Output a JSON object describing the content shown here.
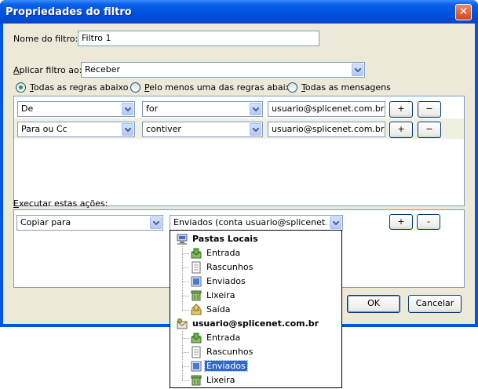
{
  "window": {
    "title": "Propriedades do filtro"
  },
  "filter_name": {
    "label": "Nome do filtro:",
    "value": "Filtro 1"
  },
  "apply_to": {
    "label_pre": "A",
    "label_post": "plicar filtro ao:",
    "value": "Receber"
  },
  "match": {
    "all_key": "T",
    "all_rest": "odas as regras abaixo",
    "any_key": "P",
    "any_rest": "elo menos uma das regras abaixo",
    "msgs_key": "T",
    "msgs_rest": "odas as mensagens",
    "selected": "Todas as regras abaixo"
  },
  "rules": [
    {
      "field": "De",
      "operator": "for",
      "value": "usuario@splicenet.com.br",
      "add": "+",
      "remove": "−"
    },
    {
      "field": "Para ou Cc",
      "operator": "contiver",
      "value": "usuario@splicenet.com.br",
      "add": "+",
      "remove": "−"
    }
  ],
  "actions": {
    "label_key": "E",
    "label_rest": "xecutar estas ações:",
    "action": "Copiar para",
    "target": "Enviados (conta usuario@splicenet.co...",
    "add": "+",
    "remove": "-"
  },
  "buttons": {
    "ok": "OK",
    "cancel": "Cancelar"
  },
  "folder_tree": {
    "groups": [
      {
        "name": "Pastas Locais",
        "icon": "computer-icon",
        "folders": [
          {
            "name": "Entrada",
            "icon": "inbox-icon"
          },
          {
            "name": "Rascunhos",
            "icon": "drafts-icon"
          },
          {
            "name": "Enviados",
            "icon": "sent-icon"
          },
          {
            "name": "Lixeira",
            "icon": "trash-icon"
          },
          {
            "name": "Saída",
            "icon": "outbox-icon"
          }
        ]
      },
      {
        "name": "usuario@splicenet.com.br",
        "icon": "account-icon",
        "folders": [
          {
            "name": "Entrada",
            "icon": "inbox-icon"
          },
          {
            "name": "Rascunhos",
            "icon": "drafts-icon"
          },
          {
            "name": "Enviados",
            "icon": "sent-icon",
            "highlighted": true
          },
          {
            "name": "Lixeira",
            "icon": "trash-icon"
          }
        ]
      }
    ]
  },
  "colors": {
    "titlebar": "#0054e3",
    "highlight": "#316ac5",
    "dialog_bg": "#ece9d8"
  }
}
